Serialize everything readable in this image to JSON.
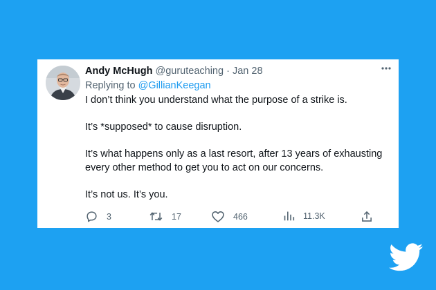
{
  "tweet": {
    "author_name": "Andy McHugh",
    "handle": "@guruteaching",
    "separator": "·",
    "date": "Jan 28",
    "replying_prefix": "Replying to",
    "replying_to": "@GillianKeegan",
    "more_icon": "more-icon",
    "paragraphs": [
      "I don’t think you understand what the purpose of a strike is.",
      "It’s *supposed* to cause disruption.",
      "It’s what happens only as a last resort, after 13 years of exhausting every other method to get you to act on our concerns.",
      "It’s not us. It’s you."
    ],
    "actions": {
      "replies": "3",
      "retweets": "17",
      "likes": "466",
      "views": "11.3K"
    }
  },
  "colors": {
    "background": "#1da1f2",
    "card": "#ffffff",
    "text": "#0f1419",
    "muted": "#536471",
    "link": "#1d9bf0"
  },
  "icons": [
    "reply-icon",
    "retweet-icon",
    "like-icon",
    "views-icon",
    "share-icon",
    "twitter-bird-icon"
  ]
}
